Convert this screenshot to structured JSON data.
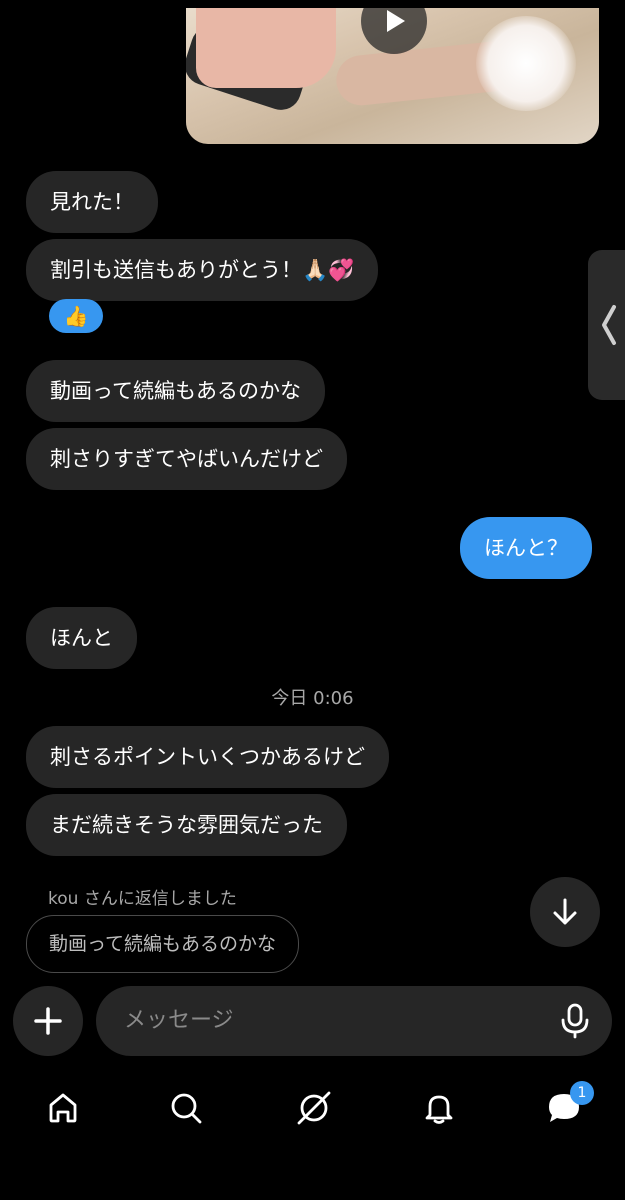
{
  "messages": {
    "m1": "見れた！",
    "m2": "割引も送信もありがとう！🙏🏻💞",
    "m2_reaction": "👍",
    "m3": "動画って続編もあるのかな",
    "m4": "刺さりすぎてやばいんだけど",
    "m5_sent": "ほんと？",
    "m6": "ほんと",
    "m7": "刺さるポイントいくつかあるけど",
    "m8": "まだ続きそうな雰囲気だった"
  },
  "timestamp": "今日 0:06",
  "reply": {
    "label": "kou さんに返信しました",
    "quoted": "動画って続編もあるのかな"
  },
  "composer": {
    "placeholder": "メッセージ"
  },
  "nav": {
    "items": [
      "home-icon",
      "search-icon",
      "explore-icon",
      "notifications-icon",
      "messages-icon"
    ],
    "messages_badge": "1"
  },
  "colors": {
    "background": "#000000",
    "bubble_received": "#262626",
    "bubble_sent": "#3797f0",
    "accent": "#3797f0"
  }
}
